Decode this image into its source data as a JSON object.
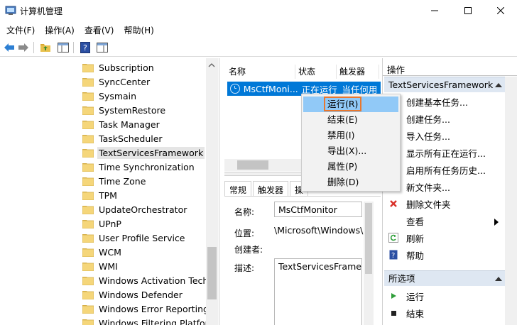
{
  "window": {
    "title": "计算机管理"
  },
  "menu": [
    "文件(F)",
    "操作(A)",
    "查看(V)",
    "帮助(H)"
  ],
  "tree": {
    "items": [
      "Subscription",
      "SyncCenter",
      "Sysmain",
      "SystemRestore",
      "Task Manager",
      "TaskScheduler",
      "TextServicesFramework",
      "Time Synchronization",
      "Time Zone",
      "TPM",
      "UpdateOrchestrator",
      "UPnP",
      "User Profile Service",
      "WCM",
      "WMI",
      "Windows Activation Techn",
      "Windows Defender",
      "Windows Error Reporting",
      "Windows Filtering Platforr"
    ],
    "selected_index": 6
  },
  "list": {
    "columns": [
      "名称",
      "状态",
      "触发器"
    ],
    "rows": [
      {
        "name": "MsCtfMoni...",
        "status": "正在运行",
        "trigger": "当任何用"
      }
    ]
  },
  "detail": {
    "tabs": [
      "常规",
      "触发器",
      "操"
    ],
    "fields": {
      "name_label": "名称:",
      "name_value": "MsCtfMonitor",
      "location_label": "位置:",
      "location_value": "\\Microsoft\\Windows\\",
      "author_label": "创建者:",
      "desc_label": "描述:",
      "desc_value": "TextServicesFramew"
    }
  },
  "context_menu": {
    "items": [
      "运行(R)",
      "结束(E)",
      "禁用(I)",
      "导出(X)...",
      "属性(P)",
      "删除(D)"
    ],
    "highlighted_index": 0
  },
  "actions": {
    "header": "操作",
    "section1": "TextServicesFramework",
    "section1_items": [
      {
        "label": "创建基本任务...",
        "icon": "create-basic-task-icon"
      },
      {
        "label": "创建任务...",
        "icon": "create-task-icon"
      },
      {
        "label": "导入任务...",
        "icon": "import-task-icon"
      },
      {
        "label": "显示所有正在运行...",
        "icon": "show-running-icon"
      },
      {
        "label": "启用所有任务历史...",
        "icon": "enable-history-icon"
      },
      {
        "label": "新文件夹...",
        "icon": "new-folder-icon"
      },
      {
        "label": "删除文件夹",
        "icon": "delete-icon"
      },
      {
        "label": "查看",
        "icon": "view-icon"
      },
      {
        "label": "刷新",
        "icon": "refresh-icon"
      },
      {
        "label": "帮助",
        "icon": "help-icon"
      }
    ],
    "section2": "所选项",
    "section2_items": [
      {
        "label": "运行",
        "icon": "run-icon"
      },
      {
        "label": "结束",
        "icon": "stop-icon"
      }
    ]
  },
  "colors": {
    "selection_blue": "#0078d7",
    "menu_hover": "#91c9f7",
    "highlight_outline": "#e8772e",
    "section_bg": "#dee7f2",
    "folder_yellow": "#f5d67a",
    "delete_red": "#d9322b",
    "run_green": "#2f9e3a"
  }
}
